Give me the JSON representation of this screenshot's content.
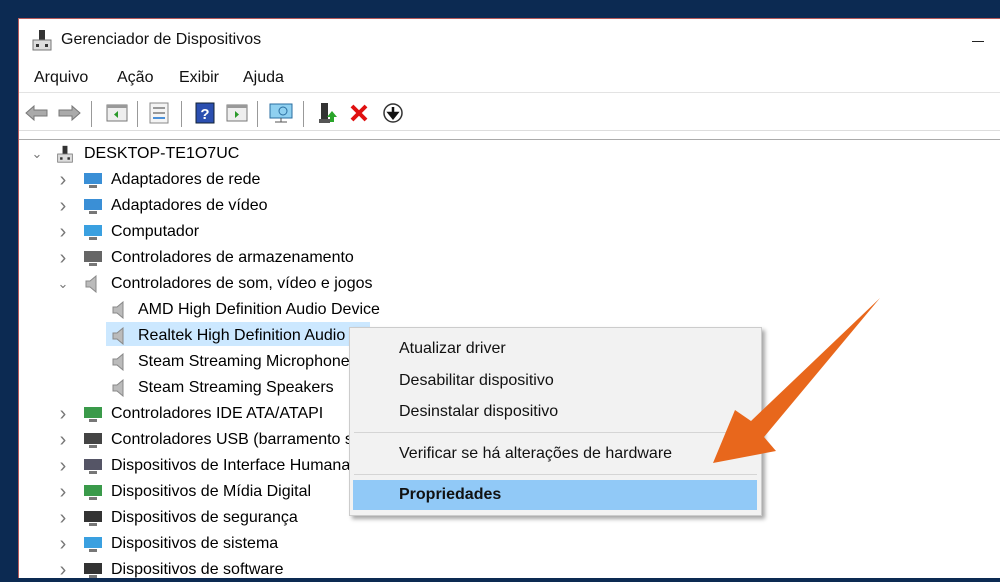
{
  "window": {
    "title": "Gerenciador de Dispositivos"
  },
  "menu": [
    "Arquivo",
    "Ação",
    "Exibir",
    "Ajuda"
  ],
  "toolbar": {
    "back": "back-icon",
    "forward": "forward-icon",
    "help": "?"
  },
  "tree": {
    "root": "DESKTOP-TE1O7UC",
    "categories": [
      {
        "label": "Adaptadores de rede"
      },
      {
        "label": "Adaptadores de vídeo"
      },
      {
        "label": "Computador"
      },
      {
        "label": "Controladores de armazenamento"
      },
      {
        "label": "Controladores de som, vídeo e jogos",
        "expanded": true
      },
      {
        "label": "AMD High Definition Audio Device",
        "child": true
      },
      {
        "label": "Realtek High Definition Audio",
        "child": true,
        "selected": true
      },
      {
        "label": "Steam Streaming Microphone",
        "child": true
      },
      {
        "label": "Steam Streaming Speakers",
        "child": true
      },
      {
        "label": "Controladores IDE ATA/ATAPI"
      },
      {
        "label": "Controladores USB (barramento serial universal)"
      },
      {
        "label": "Dispositivos de Interface Humana"
      },
      {
        "label": "Dispositivos de Mídia Digital"
      },
      {
        "label": "Dispositivos de segurança"
      },
      {
        "label": "Dispositivos de sistema"
      },
      {
        "label": "Dispositivos de software"
      }
    ]
  },
  "context_menu": {
    "items": [
      "Atualizar driver",
      "Desabilitar dispositivo",
      "Desinstalar dispositivo",
      "Verificar se há alterações de hardware",
      "Propriedades"
    ],
    "highlighted": "Propriedades"
  },
  "colors": {
    "accent_arrow": "#e8671c",
    "selection": "#cce8ff",
    "menu_highlight": "#91c9f7"
  }
}
